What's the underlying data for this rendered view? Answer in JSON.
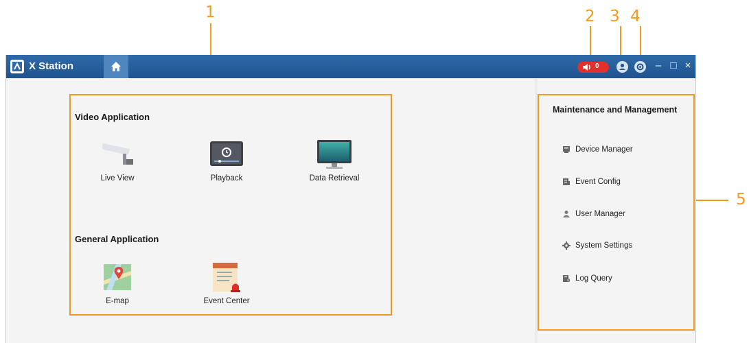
{
  "callouts": [
    "1",
    "2",
    "3",
    "4",
    "5"
  ],
  "window": {
    "title": "X Station",
    "alarm_count": "0",
    "minimize": "–",
    "maximize": "□",
    "close": "×"
  },
  "video_application": {
    "title": "Video Application",
    "apps": [
      {
        "label": "Live View",
        "icon": "camera-icon"
      },
      {
        "label": "Playback",
        "icon": "playback-icon"
      },
      {
        "label": "Data Retrieval",
        "icon": "monitor-icon"
      }
    ]
  },
  "general_application": {
    "title": "General Application",
    "apps": [
      {
        "label": "E-map",
        "icon": "map-icon"
      },
      {
        "label": "Event Center",
        "icon": "event-center-icon"
      }
    ]
  },
  "maintenance": {
    "title": "Maintenance and Management",
    "items": [
      {
        "label": "Device Manager",
        "icon": "device-icon"
      },
      {
        "label": "Event Config",
        "icon": "event-config-icon"
      },
      {
        "label": "User Manager",
        "icon": "user-icon"
      },
      {
        "label": "System Settings",
        "icon": "gear-icon"
      },
      {
        "label": "Log Query",
        "icon": "log-icon"
      }
    ]
  },
  "colors": {
    "accent": "#F39A1E",
    "titlebar": "#1f5390",
    "alarm": "#e1312e"
  }
}
